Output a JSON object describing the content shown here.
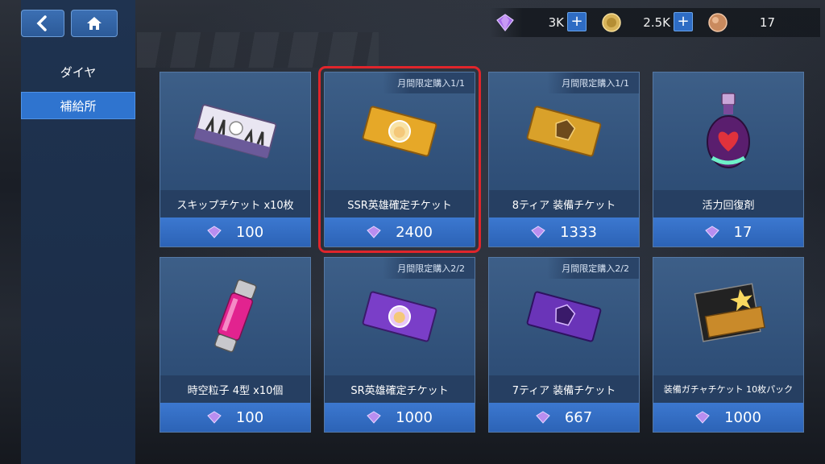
{
  "nav": {
    "back_icon": "chevron-left-icon",
    "home_icon": "home-icon"
  },
  "sidebar": {
    "items": [
      {
        "label": "ダイヤ",
        "active": false
      },
      {
        "label": "補給所",
        "active": true
      }
    ]
  },
  "currencies": {
    "diamond": {
      "value": "3K",
      "icon": "diamond-icon"
    },
    "gold": {
      "value": "2.5K",
      "icon": "coin-icon"
    },
    "stamina": {
      "value": "17",
      "icon": "stamina-orb-icon"
    },
    "plus_symbol": "+"
  },
  "colors": {
    "accent": "#2f74cf",
    "selection": "#e0252b",
    "card": "#3d5f88"
  },
  "shop": {
    "items": [
      {
        "name": "スキップチケット x10枚",
        "price": "100",
        "badge": ""
      },
      {
        "name": "SSR英雄確定チケット",
        "price": "2400",
        "badge": "月間限定購入1/1",
        "selected": true
      },
      {
        "name": "8ティア 装備チケット",
        "price": "1333",
        "badge": "月間限定購入1/1"
      },
      {
        "name": "活力回復剤",
        "price": "17",
        "badge": ""
      },
      {
        "name": "時空粒子 4型 x10個",
        "price": "100",
        "badge": ""
      },
      {
        "name": "SR英雄確定チケット",
        "price": "1000",
        "badge": "月間限定購入2/2"
      },
      {
        "name": "7ティア 装備チケット",
        "price": "667",
        "badge": "月間限定購入2/2"
      },
      {
        "name": "装備ガチャチケット 10枚パック",
        "price": "1000",
        "badge": ""
      }
    ]
  }
}
